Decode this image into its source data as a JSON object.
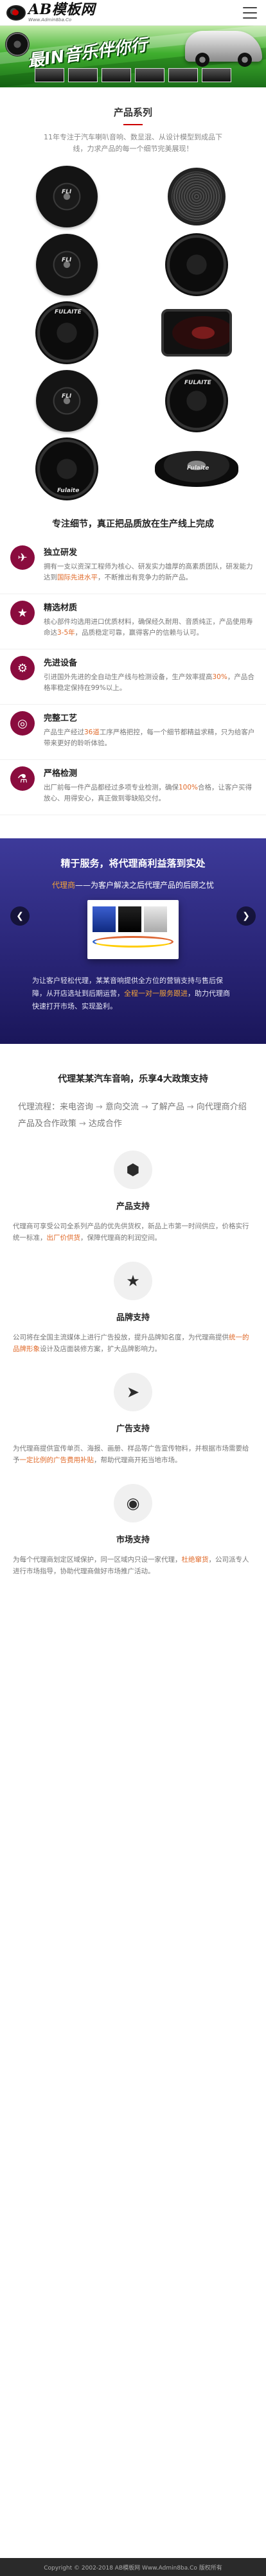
{
  "header": {
    "logo_text": "AB模板网",
    "logo_sub": "Www.Admin8ba.Co",
    "menu_icon": "hamburger-icon"
  },
  "banner": {
    "slogan": "最IN音乐伴你行"
  },
  "products": {
    "title": "产品系列",
    "desc": "11年专注于汽车喇叭音响、数显混、从设计模型到成品下线，力求产品的每一个细节完美展现！",
    "items": [
      {
        "label": "FLI"
      },
      {
        "label": ""
      },
      {
        "label": "FLI"
      },
      {
        "label": ""
      },
      {
        "label": "FULAITE"
      },
      {
        "label": ""
      },
      {
        "label": "FLI"
      },
      {
        "label": "FULAITE"
      },
      {
        "label": "Fulaite"
      },
      {
        "label": "Fulaite"
      }
    ]
  },
  "features": {
    "title": "专注细节，真正把品质放在生产线上完成",
    "items": [
      {
        "icon": "rocket-icon",
        "title": "独立研发",
        "text_a": "拥有一支以资深工程师为核心、研发实力雄厚的高素质团队，研发能力达到",
        "text_hl": "国际先进水平",
        "text_b": "，不断推出有竞争力的新产品。"
      },
      {
        "icon": "star-icon",
        "title": "精选材质",
        "text_a": "核心部件均选用进口优质材料，确保经久耐用、音质纯正，产品使用寿命达",
        "text_hl": "3-5年",
        "text_b": "，品质稳定可靠，赢得客户的信赖与认可。"
      },
      {
        "icon": "gears-icon",
        "title": "先进设备",
        "text_a": "引进国外先进的全自动生产线与检测设备，生产效率提高",
        "text_hl": "30%",
        "text_b": "，产品合格率稳定保持在99%以上。"
      },
      {
        "icon": "target-icon",
        "title": "完整工艺",
        "text_a": "产品生产经过",
        "text_hl": "36道",
        "text_b": "工序严格把控，每一个细节都精益求精，只为给客户带来更好的聆听体验。"
      },
      {
        "icon": "flask-icon",
        "title": "严格检测",
        "text_a": "出厂前每一件产品都经过多项专业检测，确保",
        "text_hl": "100%",
        "text_b": "合格，让客户买得放心、用得安心，真正做到零缺陷交付。"
      }
    ]
  },
  "slider": {
    "title": "精于服务，将代理商利益落到实处",
    "sub_hl": "代理商",
    "sub_text": "——为客户解决之后代理产品的后顾之忧",
    "prev_icon": "chevron-left-icon",
    "next_icon": "chevron-right-icon",
    "body_a": "为让客户轻松代理，某某音响提供全方位的营销支持与售后保障，从开店选址到后期运营，",
    "body_hl": "全程一对一服务跟进",
    "body_b": "，助力代理商快速打开市场、实现盈利。"
  },
  "agent": {
    "title": "代理某某汽车音响，乐享4大政策支持",
    "flow": [
      "代理流程：",
      "来电咨询",
      "意向交流",
      "了解产品",
      "向代理商介绍产品及合作政策",
      "达成合作"
    ],
    "supports": [
      {
        "icon": "cube-icon",
        "title": "产品支持",
        "text_a": "代理商可享受公司全系列产品的优先供货权，新品上市第一时间供应，价格实行统一标准，",
        "text_hl": "出厂价供货",
        "text_b": "，保障代理商的利润空间。"
      },
      {
        "icon": "star-icon",
        "title": "品牌支持",
        "text_a": "公司将在全国主流媒体上进行广告投放，提升品牌知名度，为代理商提供",
        "text_hl": "统一的品牌形象",
        "text_b": "设计及店面装修方案，扩大品牌影响力。"
      },
      {
        "icon": "send-icon",
        "title": "广告支持",
        "text_a": "为代理商提供宣传单页、海报、画册、样品等广告宣传物料，并根据市场需要给予",
        "text_hl": "一定比例的广告费用补贴",
        "text_b": "，帮助代理商开拓当地市场。"
      },
      {
        "icon": "compass-icon",
        "title": "市场支持",
        "text_a": "为每个代理商划定区域保护，同一区域内只设一家代理，",
        "text_hl": "杜绝窜货",
        "text_b": "，公司派专人进行市场指导，协助代理商做好市场推广活动。"
      }
    ]
  },
  "footer": {
    "copyright": "Copyright © 2002-2018 AB模板网 Www.Admin8ba.Co 版权所有"
  }
}
